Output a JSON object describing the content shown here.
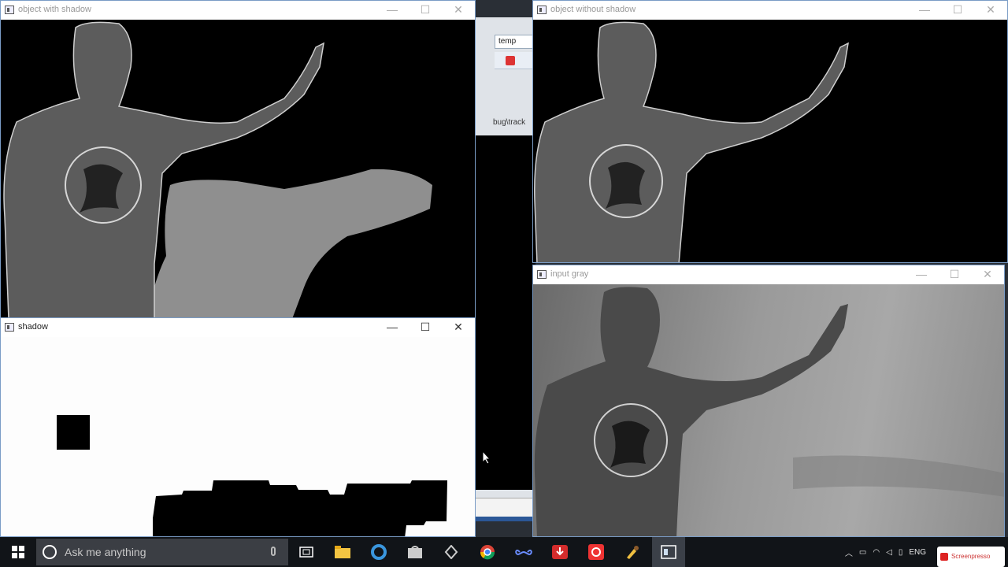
{
  "windows": {
    "object_with_shadow": {
      "title": "object with shadow"
    },
    "object_without_shadow": {
      "title": "object without shadow"
    },
    "shadow": {
      "title": "shadow"
    },
    "input_gray": {
      "title": "input gray"
    }
  },
  "controls": {
    "minimize": "—",
    "maximize": "☐",
    "close": "✕"
  },
  "background_window": {
    "tab_label": "temp",
    "path_fragment": "bug\\track"
  },
  "taskbar": {
    "search_placeholder": "Ask me anything",
    "language": "ENG",
    "icons": [
      "windows-start-icon",
      "cortana-icon",
      "microphone-icon",
      "task-view-icon",
      "file-explorer-icon",
      "edge-icon",
      "store-icon",
      "app-icon",
      "chrome-icon",
      "infinity-app-icon",
      "download-app-icon",
      "screenpresso-icon",
      "paint-icon",
      "active-window-icon"
    ],
    "tray": [
      "chevron-up-icon",
      "network-icon",
      "wifi-icon",
      "volume-icon",
      "battery-icon",
      "notification-icon"
    ]
  },
  "watermark": {
    "text": "Screenpresso"
  },
  "colors": {
    "taskbar_bg": "#111418",
    "window_border": "#7a9cc6",
    "screenpresso_red": "#d22222"
  }
}
